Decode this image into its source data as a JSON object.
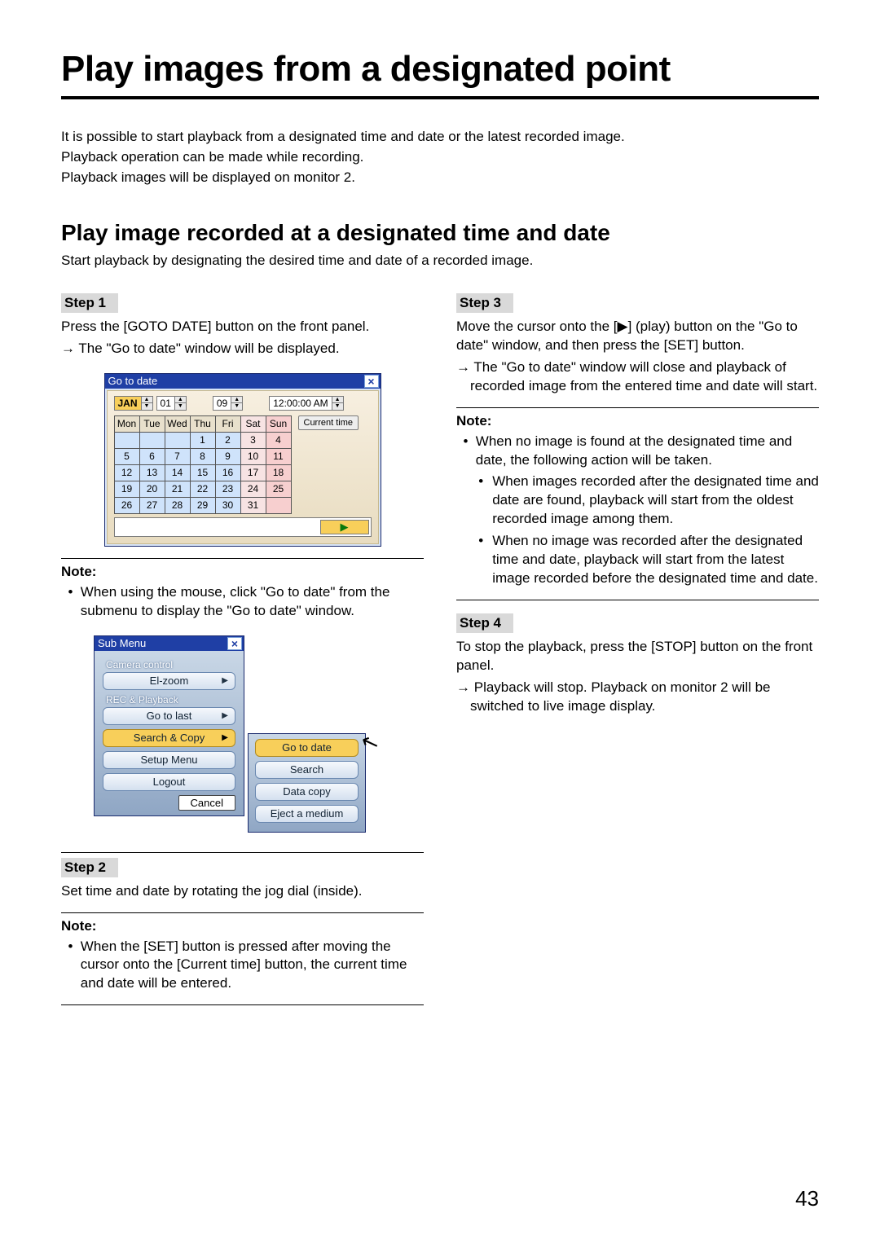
{
  "title": "Play images from a designated point",
  "intro": {
    "l1": "It is possible to start playback from a designated time and date or the latest recorded image.",
    "l2": "Playback operation can be made while recording.",
    "l3": "Playback images will be displayed on monitor 2."
  },
  "section": {
    "heading": "Play image recorded at a designated time and date",
    "lead": "Start playback by designating the desired time and date of a recorded image."
  },
  "steps": {
    "s1": {
      "hdr": "Step 1",
      "p": "Press the [GOTO DATE] button on the front panel.",
      "a": "The \"Go to date\" window will be displayed."
    },
    "s2": {
      "hdr": "Step 2",
      "p": "Set time and date by rotating the jog dial (inside)."
    },
    "s3": {
      "hdr": "Step 3",
      "p": "Move the cursor onto the [▶] (play) button on the \"Go to date\" window, and then press the [SET] button.",
      "a": "The \"Go to date\" window will close and playback of recorded image from the entered time and date will start."
    },
    "s4": {
      "hdr": "Step 4",
      "p": "To stop the playback, press the [STOP] button on the front panel.",
      "a": "Playback will stop. Playback on monitor 2 will be switched to live image display."
    }
  },
  "notes": {
    "label": "Note:",
    "n1": "When using the mouse, click \"Go to date\" from the submenu to display the \"Go to date\" window.",
    "n2": "When the [SET] button is pressed after moving the cursor onto the [Current time] button, the current time and date will be entered.",
    "n3_lead": "When no image is found at the designated time and date, the following action will be taken.",
    "n3_a": "When images recorded after the designated time and date are found, playback will start from the oldest recorded image among them.",
    "n3_b": "When no image was recorded after the designated time and date, playback will start from the latest image recorded before the designated time and date."
  },
  "gotodate": {
    "title": "Go to date",
    "month": "JAN",
    "day": "01",
    "year": "09",
    "time": "12:00:00 AM",
    "current_btn": "Current time",
    "days": [
      "Mon",
      "Tue",
      "Wed",
      "Thu",
      "Fri",
      "Sat",
      "Sun"
    ],
    "weeks": [
      [
        "",
        "",
        "",
        "1",
        "2",
        "3",
        "4"
      ],
      [
        "5",
        "6",
        "7",
        "8",
        "9",
        "10",
        "11"
      ],
      [
        "12",
        "13",
        "14",
        "15",
        "16",
        "17",
        "18"
      ],
      [
        "19",
        "20",
        "21",
        "22",
        "23",
        "24",
        "25"
      ],
      [
        "26",
        "27",
        "28",
        "29",
        "30",
        "31",
        ""
      ]
    ],
    "play_glyph": "▶"
  },
  "submenu": {
    "title": "Sub Menu",
    "grp1": "Camera control",
    "i_elzoom": "El-zoom",
    "grp2": "REC & Playback",
    "i_gotolast": "Go to last",
    "i_search": "Search & Copy",
    "i_setup": "Setup Menu",
    "i_logout": "Logout",
    "cancel": "Cancel",
    "fly": {
      "gotodate": "Go to date",
      "search": "Search",
      "datacopy": "Data copy",
      "eject": "Eject a medium"
    }
  },
  "page_number": "43"
}
